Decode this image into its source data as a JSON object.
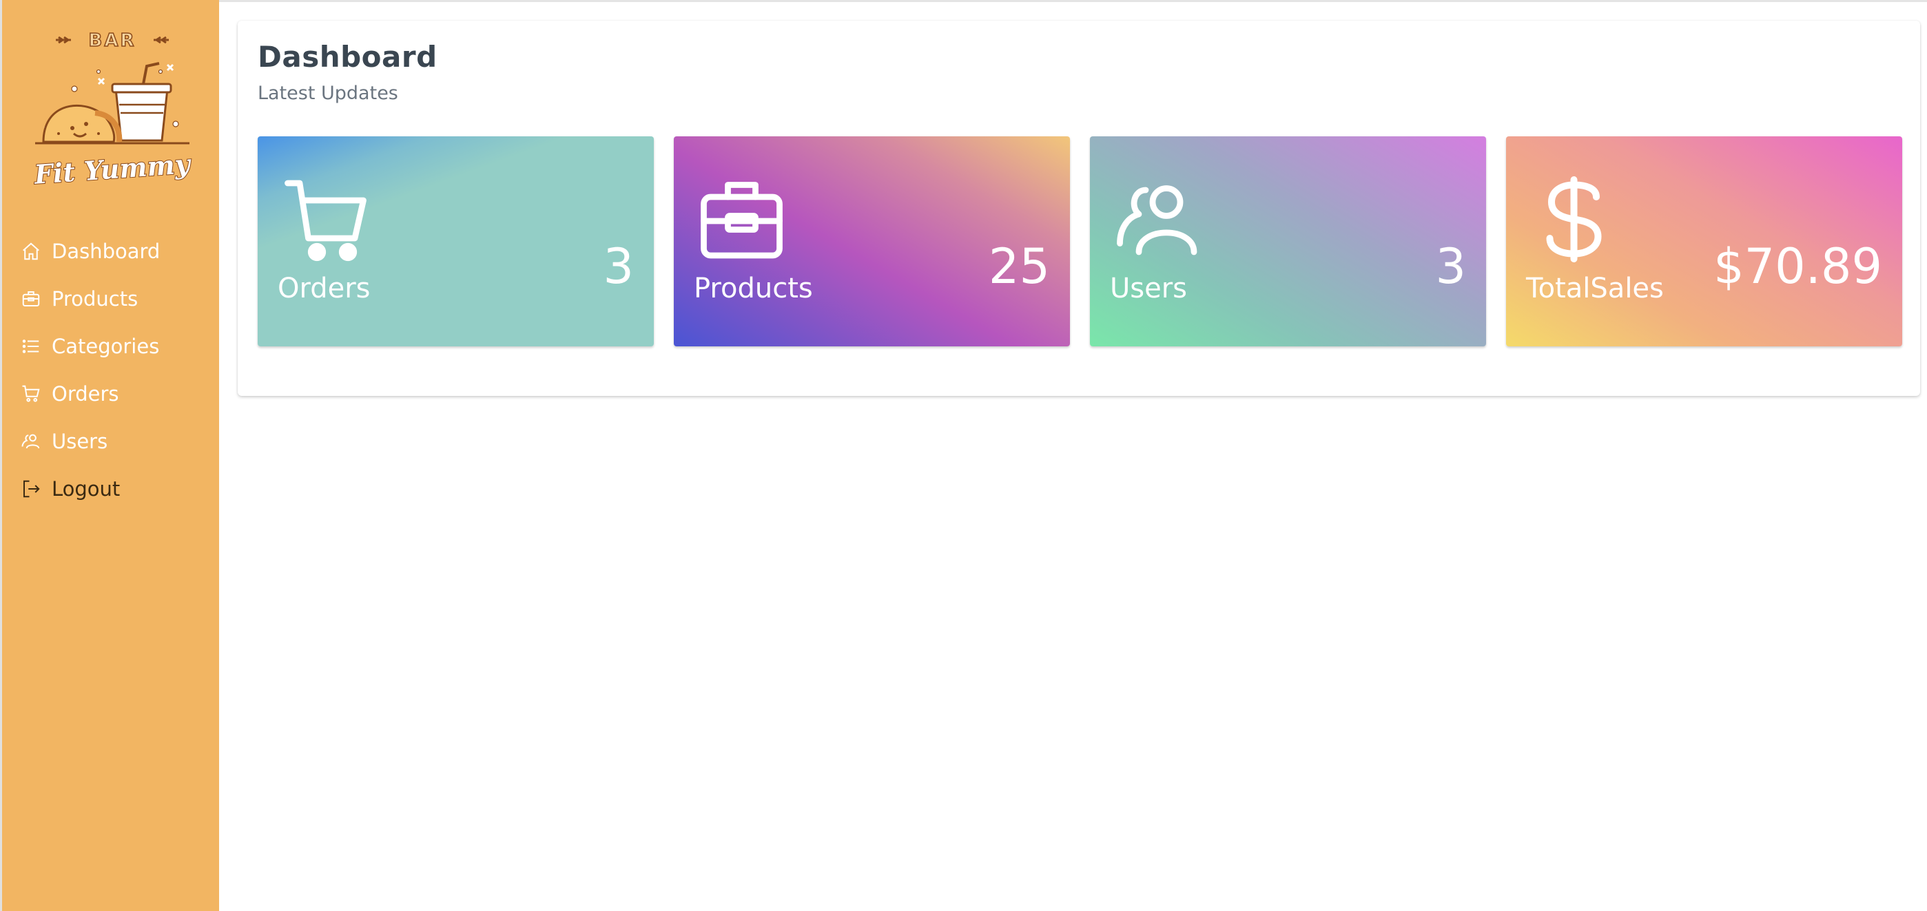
{
  "sidebar": {
    "logo": {
      "top_text": "BAR",
      "brand": "Fit Yummy",
      "icon": "taco-and-drink-logo"
    },
    "items": [
      {
        "label": "Dashboard",
        "icon": "home-icon"
      },
      {
        "label": "Products",
        "icon": "briefcase-icon"
      },
      {
        "label": "Categories",
        "icon": "list-icon"
      },
      {
        "label": "Orders",
        "icon": "cart-icon"
      },
      {
        "label": "Users",
        "icon": "users-icon"
      },
      {
        "label": "Logout",
        "icon": "logout-icon"
      }
    ]
  },
  "header": {
    "title": "Dashboard",
    "subtitle": "Latest Updates"
  },
  "stats": [
    {
      "label": "Orders",
      "value": "3",
      "icon": "cart-icon"
    },
    {
      "label": "Products",
      "value": "25",
      "icon": "briefcase-icon"
    },
    {
      "label": "Users",
      "value": "3",
      "icon": "users-icon"
    },
    {
      "label": "TotalSales",
      "value": "$70.89",
      "icon": "dollar-icon"
    }
  ],
  "colors": {
    "sidebar_bg": "#f2b562",
    "title_text": "#3a4651",
    "subtitle_text": "#6b7580",
    "logout_text": "#3b2a12"
  }
}
